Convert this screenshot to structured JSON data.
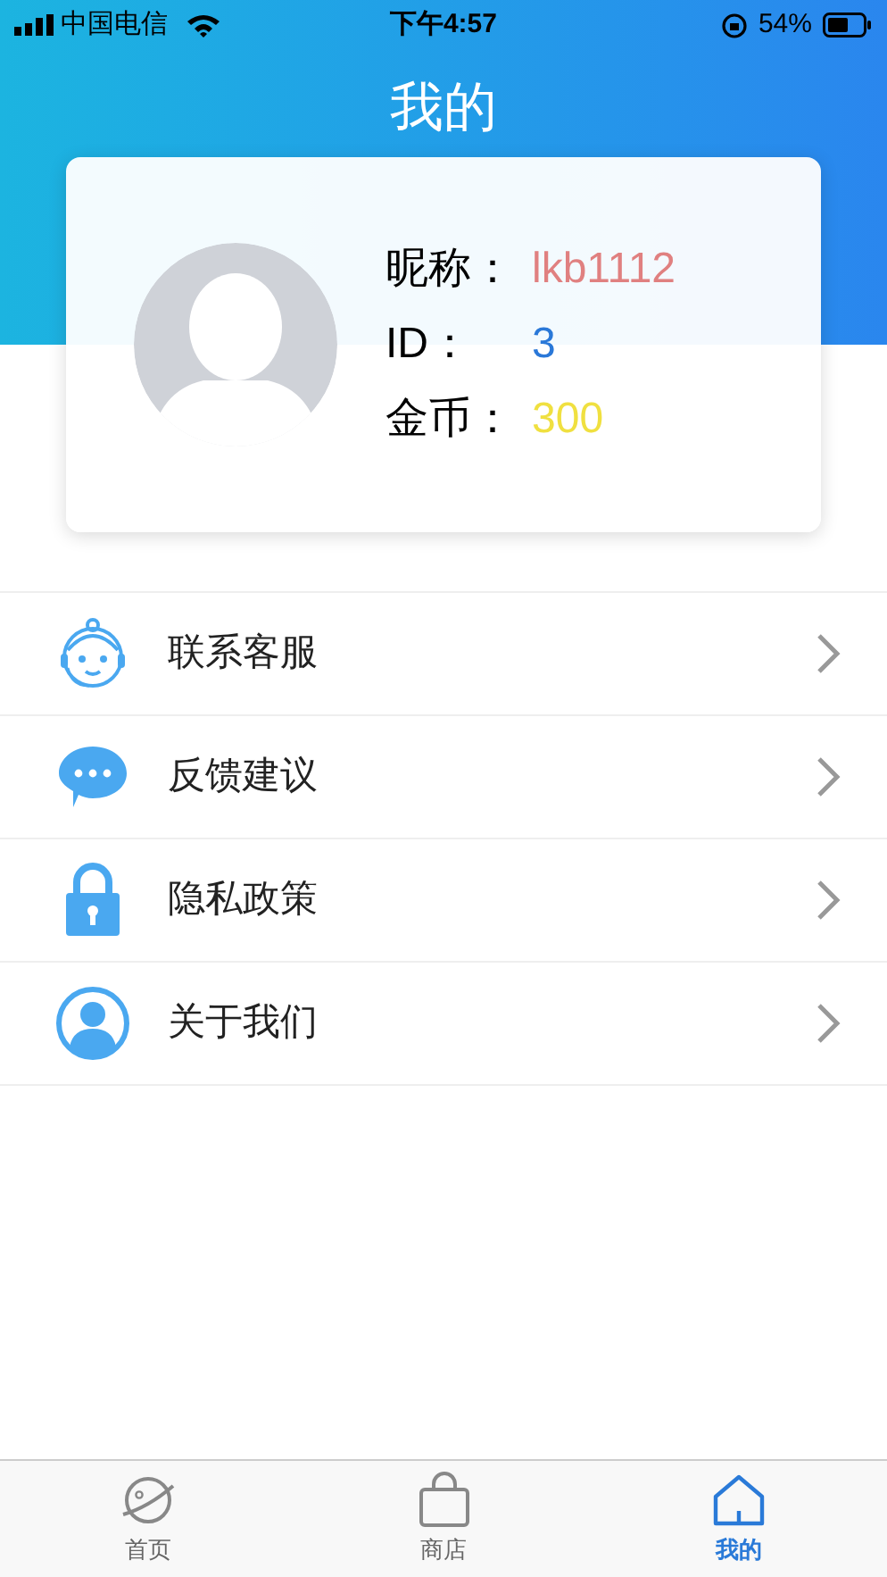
{
  "status_bar": {
    "carrier": "中国电信",
    "time": "下午4:57",
    "battery": "54%"
  },
  "header": {
    "title": "我的"
  },
  "profile": {
    "fields": [
      {
        "label": "昵称：",
        "value": "lkb1112",
        "color": "#e08080"
      },
      {
        "label": "ID：",
        "value": "3",
        "color": "#2a78d8"
      },
      {
        "label": "金币：",
        "value": "300",
        "color": "#f0e040"
      }
    ]
  },
  "menu": [
    {
      "kind": "service",
      "label": "联系客服"
    },
    {
      "kind": "chat",
      "label": "反馈建议"
    },
    {
      "kind": "lock",
      "label": "隐私政策"
    },
    {
      "kind": "user",
      "label": "关于我们"
    }
  ],
  "tab_bar": [
    {
      "kind": "planet",
      "label": "首页",
      "selected": false
    },
    {
      "kind": "bag",
      "label": "商店",
      "selected": false
    },
    {
      "kind": "home",
      "label": "我的",
      "selected": true
    }
  ]
}
